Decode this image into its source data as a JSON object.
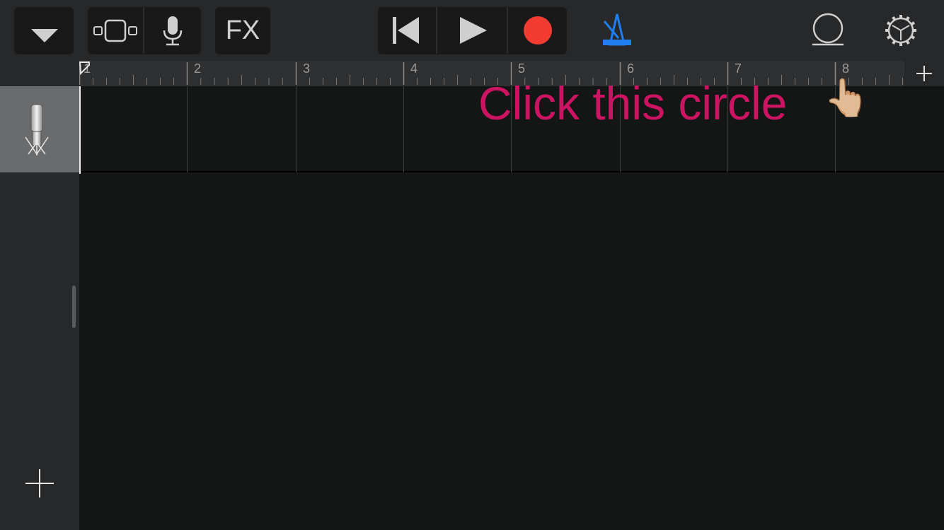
{
  "toolbar": {
    "tracks_menu": "chevron-down-icon",
    "view_toggle": "track-view-icon",
    "mic_icon": "microphone-icon",
    "fx_label": "FX",
    "rewind": "rewind-to-start-icon",
    "play": "play-icon",
    "record": "record-icon",
    "metronome": "metronome-icon",
    "loop_browser": "loop-icon",
    "settings": "gear-icon",
    "record_color": "#f23c32",
    "metronome_color": "#1e7ef2"
  },
  "ruler": {
    "bars": [
      "1",
      "2",
      "3",
      "4",
      "5",
      "6",
      "7",
      "8"
    ],
    "add_section": "plus-icon"
  },
  "tracks": [
    {
      "instrument_icon": "condenser-microphone-icon"
    }
  ],
  "add_track": "plus-icon",
  "annotation": {
    "text": "Click this circle",
    "pointer": "👆🏼"
  }
}
